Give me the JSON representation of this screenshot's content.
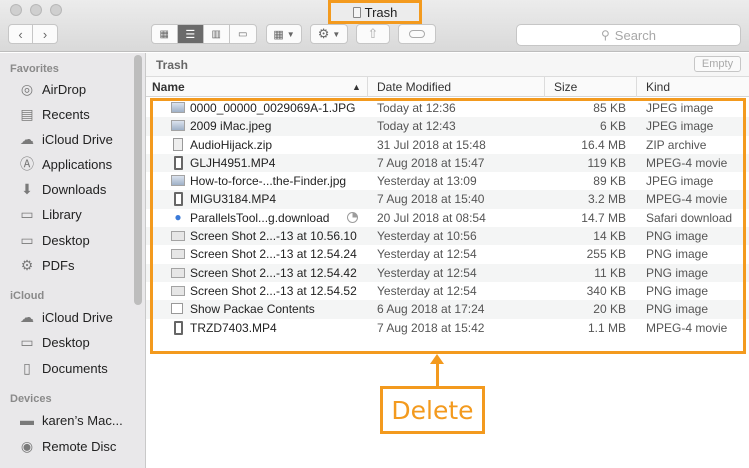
{
  "window": {
    "title": "Trash"
  },
  "toolbar": {
    "back_icon": "chevron-left-icon",
    "forward_icon": "chevron-right-icon",
    "view_modes": [
      "icon-view-icon",
      "list-view-icon",
      "column-view-icon",
      "gallery-view-icon"
    ],
    "active_view": "list",
    "search_placeholder": "Search"
  },
  "sidebar": {
    "sections": [
      {
        "heading": "Favorites",
        "items": [
          {
            "label": "AirDrop",
            "icon": "airdrop-icon"
          },
          {
            "label": "Recents",
            "icon": "recents-icon"
          },
          {
            "label": "iCloud Drive",
            "icon": "cloud-icon"
          },
          {
            "label": "Applications",
            "icon": "applications-icon"
          },
          {
            "label": "Downloads",
            "icon": "downloads-icon"
          },
          {
            "label": "Library",
            "icon": "folder-icon"
          },
          {
            "label": "Desktop",
            "icon": "desktop-icon"
          },
          {
            "label": "PDFs",
            "icon": "gear-folder-icon"
          }
        ]
      },
      {
        "heading": "iCloud",
        "items": [
          {
            "label": "iCloud Drive",
            "icon": "cloud-icon"
          },
          {
            "label": "Desktop",
            "icon": "desktop-icon"
          },
          {
            "label": "Documents",
            "icon": "documents-icon"
          }
        ]
      },
      {
        "heading": "Devices",
        "items": [
          {
            "label": "karen’s Mac...",
            "icon": "disk-icon"
          },
          {
            "label": "Remote Disc",
            "icon": "disc-icon"
          }
        ]
      }
    ]
  },
  "pathbar": {
    "crumb": "Trash",
    "empty_label": "Empty"
  },
  "columns": {
    "name": "Name",
    "date": "Date Modified",
    "size": "Size",
    "kind": "Kind"
  },
  "files": [
    {
      "name": "0000_00000_0029069A-1.JPG",
      "date": "Today at 12:36",
      "size": "85 KB",
      "kind": "JPEG image",
      "icon": "img"
    },
    {
      "name": "2009 iMac.jpeg",
      "date": "Today at 12:43",
      "size": "6 KB",
      "kind": "JPEG image",
      "icon": "img"
    },
    {
      "name": "AudioHijack.zip",
      "date": "31 Jul 2018 at 15:48",
      "size": "16.4 MB",
      "kind": "ZIP archive",
      "icon": "zip"
    },
    {
      "name": "GLJH4951.MP4",
      "date": "7 Aug 2018 at 15:47",
      "size": "119 KB",
      "kind": "MPEG-4 movie",
      "icon": "mov"
    },
    {
      "name": "How-to-force-...the-Finder.jpg",
      "date": "Yesterday at 13:09",
      "size": "89 KB",
      "kind": "JPEG image",
      "icon": "img"
    },
    {
      "name": "MIGU3184.MP4",
      "date": "7 Aug 2018 at 15:40",
      "size": "3.2 MB",
      "kind": "MPEG-4 movie",
      "icon": "mov"
    },
    {
      "name": "ParallelsTool...g.download",
      "date": "20 Jul 2018 at 08:54",
      "size": "14.7 MB",
      "kind": "Safari download",
      "icon": "dl",
      "progress": 0.25
    },
    {
      "name": "Screen Shot 2...-13 at 10.56.10",
      "date": "Yesterday at 10:56",
      "size": "14 KB",
      "kind": "PNG image",
      "icon": "shot"
    },
    {
      "name": "Screen Shot 2...-13 at 12.54.24",
      "date": "Yesterday at 12:54",
      "size": "255 KB",
      "kind": "PNG image",
      "icon": "shot"
    },
    {
      "name": "Screen Shot 2...-13 at 12.54.42",
      "date": "Yesterday at 12:54",
      "size": "11 KB",
      "kind": "PNG image",
      "icon": "shot"
    },
    {
      "name": "Screen Shot 2...-13 at 12.54.52",
      "date": "Yesterday at 12:54",
      "size": "340 KB",
      "kind": "PNG image",
      "icon": "shot"
    },
    {
      "name": "Show Packae Contents",
      "date": "6 Aug 2018 at 17:24",
      "size": "20 KB",
      "kind": "PNG image",
      "icon": "doc"
    },
    {
      "name": "TRZD7403.MP4",
      "date": "7 Aug 2018 at 15:42",
      "size": "1.1 MB",
      "kind": "MPEG-4 movie",
      "icon": "mov"
    }
  ],
  "annotation": {
    "label": "Delete",
    "color": "#f39a1e"
  }
}
